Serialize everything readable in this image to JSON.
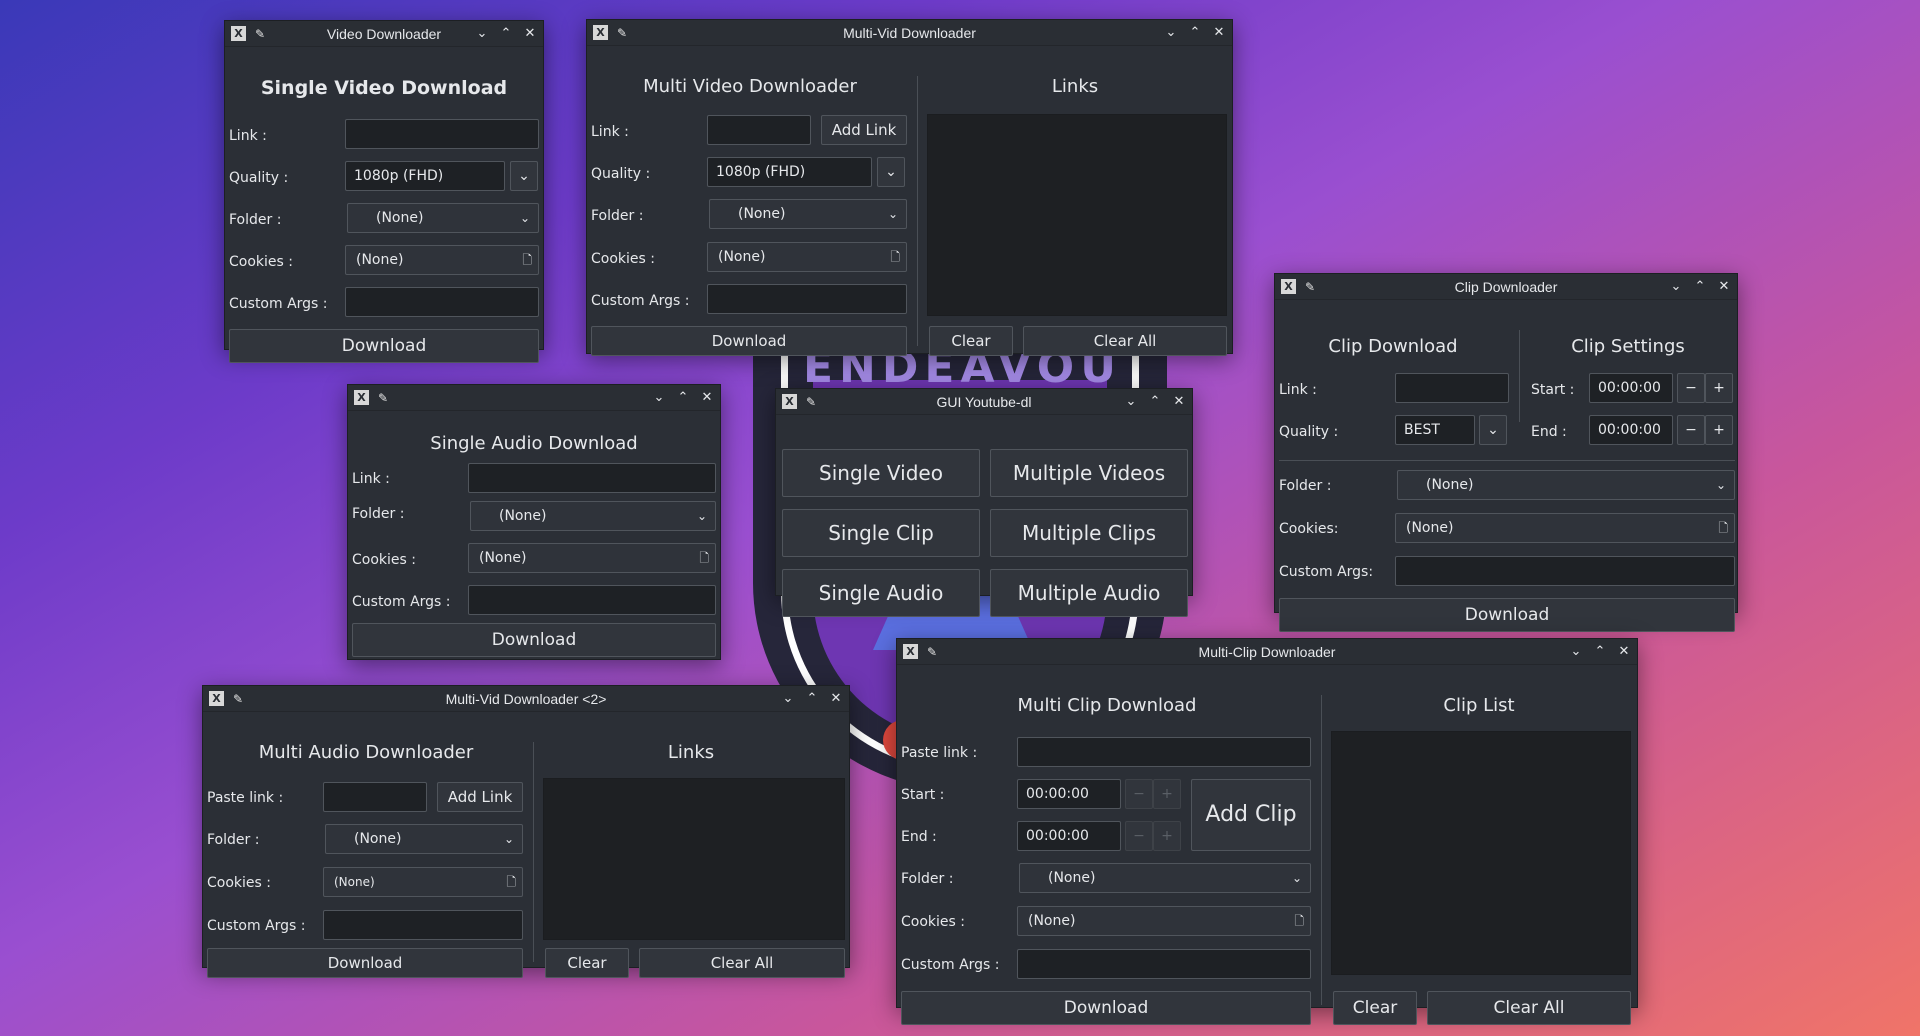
{
  "colors": {
    "window_bg": "#2b2f36",
    "input_bg": "#1e2125",
    "border": "#50555c",
    "text": "#e6e8eb"
  },
  "icons": {
    "app": "x-app-icon",
    "pin": "pin-icon",
    "minimize": "chevron-down-icon",
    "maximize": "chevron-up-icon",
    "close": "close-icon",
    "file": "file-icon"
  },
  "background": {
    "emblem_text": "ENDEAVOUROS"
  },
  "single_video": {
    "window_title": "Video Downloader",
    "heading": "Single Video Download",
    "link_label": "Link :",
    "link_value": "",
    "quality_label": "Quality :",
    "quality_value": "1080p (FHD)",
    "folder_label": "Folder :",
    "folder_value": "(None)",
    "cookies_label": "Cookies :",
    "cookies_value": "(None)",
    "args_label": "Custom Args :",
    "args_value": "",
    "download": "Download"
  },
  "multi_video": {
    "window_title": "Multi-Vid Downloader",
    "heading": "Multi Video Downloader",
    "links_heading": "Links",
    "link_label": "Link :",
    "link_value": "",
    "add_link": "Add Link",
    "quality_label": "Quality :",
    "quality_value": "1080p (FHD)",
    "folder_label": "Folder :",
    "folder_value": "(None)",
    "cookies_label": "Cookies :",
    "cookies_value": "(None)",
    "args_label": "Custom Args :",
    "args_value": "",
    "download": "Download",
    "clear": "Clear",
    "clear_all": "Clear All"
  },
  "single_audio": {
    "window_title": "",
    "heading": "Single Audio Download",
    "link_label": "Link :",
    "link_value": "",
    "folder_label": "Folder :",
    "folder_value": "(None)",
    "cookies_label": "Cookies :",
    "cookies_value": "(None)",
    "args_label": "Custom Args :",
    "args_value": "",
    "download": "Download"
  },
  "main_menu": {
    "window_title": "GUI Youtube-dl",
    "buttons": [
      "Single Video",
      "Multiple Videos",
      "Single Clip",
      "Multiple Clips",
      "Single Audio",
      "Multiple Audio"
    ]
  },
  "clip": {
    "window_title": "Clip Downloader",
    "heading": "Clip Download",
    "settings_heading": "Clip Settings",
    "link_label": "Link :",
    "link_value": "",
    "quality_label": "Quality :",
    "quality_value": "BEST",
    "start_label": "Start :",
    "start_value": "00:00:00",
    "end_label": "End :",
    "end_value": "00:00:00",
    "minus": "−",
    "plus": "+",
    "folder_label": "Folder :",
    "folder_value": "(None)",
    "cookies_label": "Cookies:",
    "cookies_value": "(None)",
    "args_label": "Custom Args:",
    "args_value": "",
    "download": "Download"
  },
  "multi_audio": {
    "window_title": "Multi-Vid Downloader <2>",
    "heading": "Multi Audio Downloader",
    "links_heading": "Links",
    "link_label": "Paste link :",
    "link_value": "",
    "add_link": "Add Link",
    "folder_label": "Folder :",
    "folder_value": "(None)",
    "cookies_label": "Cookies :",
    "cookies_value": "(None)",
    "args_label": "Custom Args :",
    "args_value": "",
    "download": "Download",
    "clear": "Clear",
    "clear_all": "Clear All"
  },
  "multi_clip": {
    "window_title": "Multi-Clip Downloader",
    "heading": "Multi Clip Download",
    "list_heading": "Clip List",
    "link_label": "Paste link :",
    "link_value": "",
    "start_label": "Start :",
    "start_value": "00:00:00",
    "end_label": "End :",
    "end_value": "00:00:00",
    "minus": "−",
    "plus": "+",
    "add_clip": "Add Clip",
    "folder_label": "Folder :",
    "folder_value": "(None)",
    "cookies_label": "Cookies :",
    "cookies_value": "(None)",
    "args_label": "Custom Args :",
    "args_value": "",
    "download": "Download",
    "clear": "Clear",
    "clear_all": "Clear All"
  }
}
